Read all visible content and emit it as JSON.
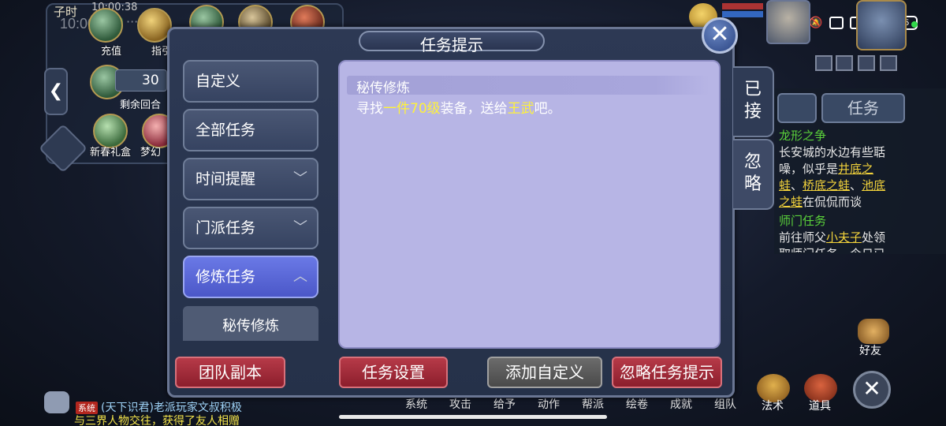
{
  "status_bar": {
    "time": "10:00",
    "dots": "···",
    "battery": "15"
  },
  "hud": {
    "shichen": "子时",
    "clock": "10:00:38",
    "recharge": "充值",
    "guide": "指引",
    "counter": "30",
    "remaining_rounds": "剩余回合",
    "spring_gift": "新春礼盒",
    "dream": "梦幻",
    "task_tab": "任务",
    "friends": "好友",
    "close": "✕",
    "left_arrow": "❮"
  },
  "right_panel": {
    "quest1_title": "龙形之争",
    "quest1_text_a": "长安城的水边有些聒噪，似乎是",
    "quest1_link_a": "井底之蛙",
    "quest1_sep": "、",
    "quest1_link_b": "桥底之蛙",
    "quest1_sep2": "、",
    "quest1_link_c": "池底之蛙",
    "quest1_text_b": "在侃侃而谈",
    "quest2_title": "师门任务",
    "quest2_text_a": "前往师父",
    "quest2_link": "小夫子",
    "quest2_text_b": "处领取师门任务，今日已"
  },
  "dialog": {
    "title": "任务提示",
    "categories": [
      {
        "label": "自定义"
      },
      {
        "label": "全部任务"
      },
      {
        "label": "时间提醒",
        "chevron": "﹀"
      },
      {
        "label": "门派任务",
        "chevron": "﹀"
      },
      {
        "label": "修炼任务",
        "chevron": "︿"
      }
    ],
    "sub_item": "秘传修炼",
    "content": {
      "heading": "秘传修炼",
      "body_prefix": "寻找",
      "highlight1": "一件70级",
      "body_mid": "装备，送给",
      "highlight2": "王武",
      "body_suffix": "吧。"
    },
    "side_tabs": {
      "accepted": [
        "已",
        "接"
      ],
      "ignored": [
        "忽",
        "略"
      ]
    },
    "footer": {
      "team_dungeon": "团队副本",
      "task_settings": "任务设置",
      "add_custom": "添加自定义",
      "ignore_hint": "忽略任务提示"
    }
  },
  "bottom_menu": [
    "系统",
    "攻击",
    "给予",
    "动作",
    "帮派",
    "绘卷",
    "成就",
    "组队"
  ],
  "bottom_big": {
    "spell": "法术",
    "item": "道具"
  },
  "chat": {
    "sys_tag": "系统",
    "line1": "(天下识君)老派玩家文叔积极",
    "line2": "与三界人物交往，获得了友人相赠"
  },
  "colors": {
    "accent_active": "#5a67d8",
    "highlight": "#fff23a",
    "content_bg": "#b7b5e5",
    "button_red": "#a0303e"
  }
}
